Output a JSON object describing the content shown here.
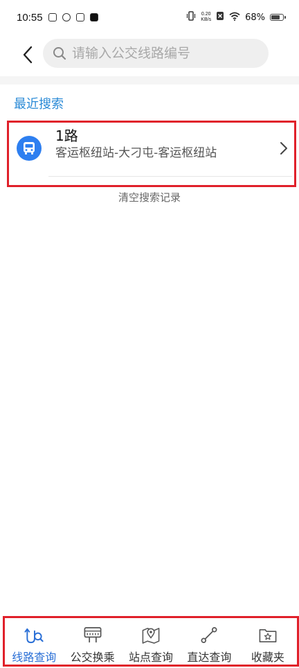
{
  "status_bar": {
    "time": "10:55",
    "net_speed_value": "0.20",
    "net_speed_unit": "KB/s",
    "battery": "68%"
  },
  "header": {
    "search_placeholder": "请输入公交线路编号"
  },
  "recent": {
    "title": "最近搜索",
    "items": [
      {
        "name": "1路",
        "description": "客运枢纽站-大刁屯-客运枢纽站"
      }
    ],
    "clear_label": "清空搜索记录"
  },
  "nav": {
    "items": [
      {
        "label": "线路查询",
        "icon": "route-search-icon",
        "active": true
      },
      {
        "label": "公交换乘",
        "icon": "bus-transfer-icon",
        "active": false
      },
      {
        "label": "站点查询",
        "icon": "map-pin-icon",
        "active": false
      },
      {
        "label": "直达查询",
        "icon": "direct-route-icon",
        "active": false
      },
      {
        "label": "收藏夹",
        "icon": "star-folder-icon",
        "active": false
      }
    ]
  },
  "colors": {
    "accent": "#2a8ad6",
    "highlight_border": "#e0202a",
    "bus_icon_bg": "#2e7ff0"
  }
}
